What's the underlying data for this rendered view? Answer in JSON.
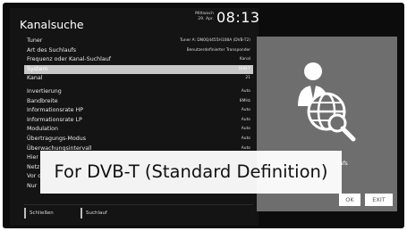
{
  "header": {
    "title": "Kanalsuche",
    "day": "Mittwoch",
    "date": "29. Apr.",
    "time": "08:13"
  },
  "menu": {
    "items": [
      {
        "label": "Tuner",
        "value": "Tuner A: DN0Q4455H108A (DVB-T2)"
      },
      {
        "label": "Art des Suchlaufs",
        "value": "Benutzerdefinierter Transponder"
      },
      {
        "label": "Frequenz oder Kanal-Suchlauf",
        "value": "Kanal"
      },
      {
        "label": "System",
        "value": "DVB-T"
      },
      {
        "label": "Kanal",
        "value": "21"
      },
      {
        "label": "Invertierung",
        "value": "Auto"
      },
      {
        "label": "Bandbreite",
        "value": "8MHz"
      },
      {
        "label": "Informationsrate HP",
        "value": "Auto"
      },
      {
        "label": "Informationsrate LP",
        "value": "Auto"
      },
      {
        "label": "Modulation",
        "value": "Auto"
      },
      {
        "label": "Übertragungs-Modus",
        "value": "Auto"
      },
      {
        "label": "Überwachungsintervall",
        "value": "Auto"
      },
      {
        "label": "Hier",
        "value": ""
      },
      {
        "label": "Netz",
        "value": ""
      },
      {
        "label": "Vor c",
        "value": ""
      },
      {
        "label": "Nur",
        "value": ""
      }
    ],
    "selected_index": 3
  },
  "footer": {
    "back_label": "Schließen",
    "scan_label": "Suchlauf"
  },
  "panel": {
    "text": "aufs",
    "ok_label": "OK",
    "exit_label": "EXIT"
  },
  "subtitle": "For DVB-T (Standard Definition)",
  "icons": {
    "panel_icon": "user-globe-search-icon"
  },
  "colors": {
    "background": "#0c0c0c",
    "menu": "#141414",
    "selection": "#c8c8c8",
    "panel": "#6e6e6e"
  }
}
